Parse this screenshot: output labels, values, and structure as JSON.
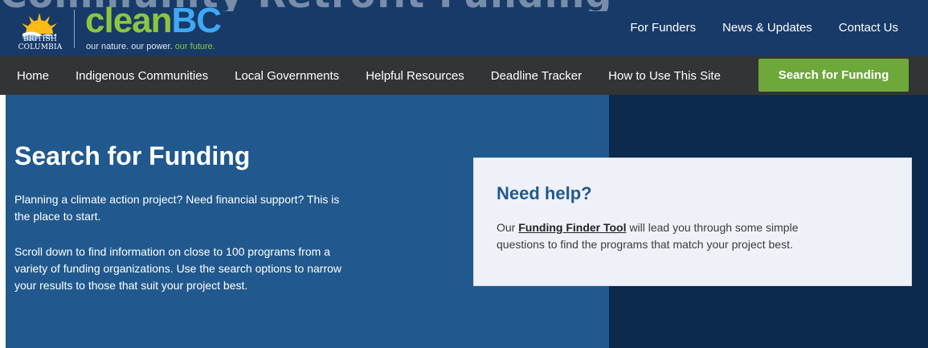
{
  "header": {
    "ghost_text": "Community Retrofit Funding",
    "government": {
      "line1": "British",
      "line2": "Columbia"
    },
    "brand": {
      "part1": "clean",
      "part2": "BC"
    },
    "tagline": {
      "part1": "our nature. our power. ",
      "part2": "our future."
    },
    "top_links": [
      "For Funders",
      "News & Updates",
      "Contact Us"
    ]
  },
  "nav": {
    "items": [
      "Home",
      "Indigenous Communities",
      "Local Governments",
      "Helpful Resources",
      "Deadline Tracker",
      "How to Use This Site"
    ],
    "cta": "Search for Funding"
  },
  "hero": {
    "title": "Search for Funding",
    "paragraph1": "Planning a climate action project? Need financial support? This is the place to start.",
    "paragraph2": "Scroll down to find information on close to 100 programs from a variety of funding organizations. Use the search options to narrow your results to those that suit your project best."
  },
  "help_card": {
    "title": "Need help?",
    "text_before": "Our ",
    "link": "Funding Finder Tool",
    "text_after": " will lead you through some simple questions to find the programs that match your project best."
  },
  "colors": {
    "header_bg": "#183a69",
    "nav_bg": "#323436",
    "cta_green": "#6ea83a",
    "hero_blue": "#21598e",
    "hero_dark": "#0c2a4e",
    "card_bg": "#eef1f8"
  },
  "icons": [
    "bc-sun-logo"
  ]
}
